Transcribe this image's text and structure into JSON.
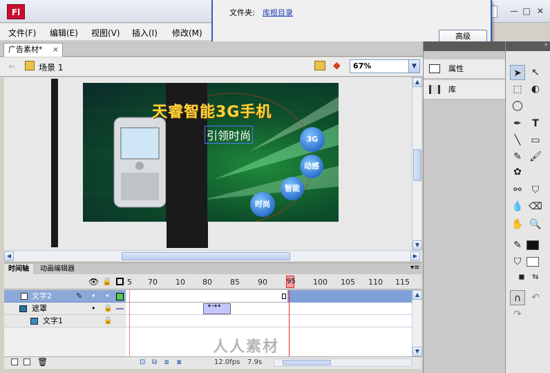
{
  "app": {
    "logo_text": "Fl",
    "window_buttons": [
      "—",
      "□",
      "✕"
    ]
  },
  "dialog": {
    "folder_label": "文件夹:",
    "folder_link": "库根目录",
    "advanced_button": "高级"
  },
  "menu": [
    "文件(F)",
    "编辑(E)",
    "视图(V)",
    "插入(I)",
    "修改(M)"
  ],
  "document_tab": {
    "label": "广告素材*",
    "close": "×"
  },
  "editbar": {
    "scene_label": "场景 1",
    "zoom_value": "67%"
  },
  "stage": {
    "banner_title": "天睿智能3G手机",
    "selected_text": "引领时尚",
    "bubbles": [
      "3G",
      "动感",
      "智能",
      "时尚"
    ]
  },
  "timeline": {
    "tabs": [
      "时间轴",
      "动画编辑器"
    ],
    "ruler_labels": [
      "5",
      "70",
      "10",
      "80",
      "85",
      "90",
      "95",
      "100",
      "105",
      "110",
      "115"
    ],
    "layers": [
      {
        "name": "文字2",
        "selected": true,
        "color": "#55cc55"
      },
      {
        "name": "遮罩",
        "selected": false,
        "color": "#8866cc"
      },
      {
        "name": "文字1",
        "selected": false,
        "color": "#dddddd"
      }
    ],
    "playhead_frame": "95",
    "fps": "12.0fps",
    "time": "7.9s"
  },
  "panels": {
    "properties": "属性",
    "library": "库"
  },
  "watermark": "人人素材"
}
